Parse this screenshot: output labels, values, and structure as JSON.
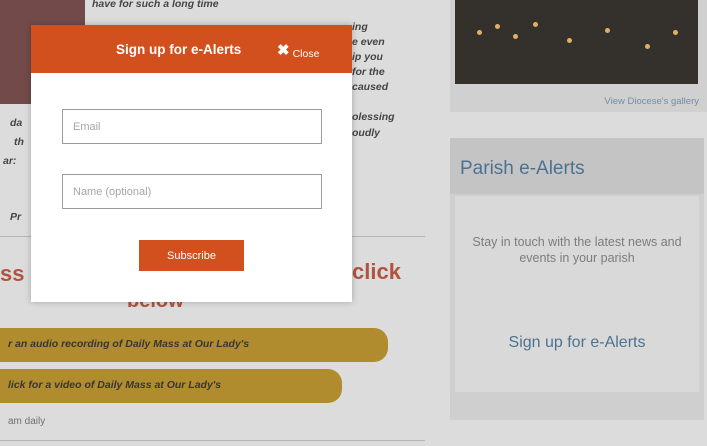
{
  "background": {
    "intro_lines": [
      "have for such a long time",
      "ing",
      "e even",
      "ip you",
      "for the",
      "caused",
      "olessing",
      "oudly"
    ],
    "left_fragments": [
      "da",
      "th",
      "ar:"
    ],
    "pr_fragment": "Pr",
    "headline_left": "ss",
    "headline_right": "click",
    "headline_below": "below",
    "audio_button": "r an audio recording of Daily Mass at Our Lady's",
    "video_button": "lick for a video of Daily Mass at Our Lady's",
    "small_note": "am daily",
    "gallery_link": "View Diocese's gallery",
    "alerts_title": "Parish e-Alerts",
    "alerts_text": "Stay in touch with the latest news and events in your parish",
    "alerts_link": "Sign up for e-Alerts"
  },
  "modal": {
    "title": "Sign up for e-Alerts",
    "close_icon": "close-icon",
    "close_label": "Close",
    "email_placeholder": "Email",
    "name_placeholder": "Name (optional)",
    "subscribe_label": "Subscribe"
  },
  "colors": {
    "accent": "#d2501d",
    "headline": "#b6452c",
    "link": "#3e6b8f",
    "pill": "#b68a19"
  }
}
